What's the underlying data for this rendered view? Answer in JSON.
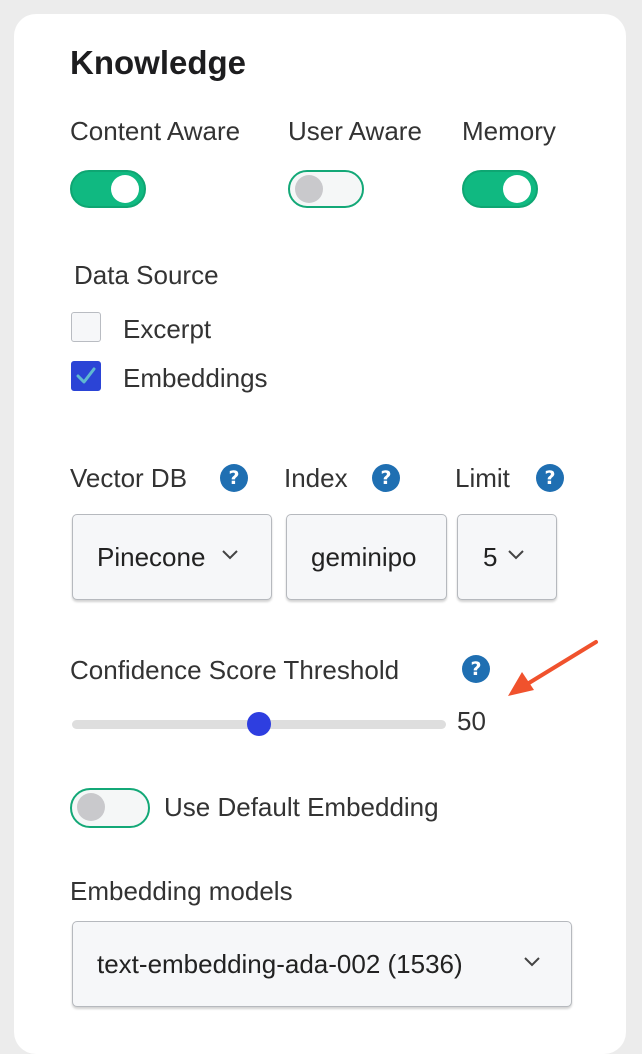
{
  "section": {
    "title": "Knowledge"
  },
  "toggles": [
    {
      "label": "Content Aware",
      "on": true
    },
    {
      "label": "User Aware",
      "on": false
    },
    {
      "label": "Memory",
      "on": true
    }
  ],
  "data_source": {
    "label": "Data Source",
    "options": [
      {
        "label": "Excerpt",
        "checked": false
      },
      {
        "label": "Embeddings",
        "checked": true
      }
    ]
  },
  "vector_db": {
    "label": "Vector DB",
    "value": "Pinecone",
    "help_icon": "question-circle"
  },
  "index": {
    "label": "Index",
    "value": "geminipo",
    "help_icon": "question-circle"
  },
  "limit": {
    "label": "Limit",
    "value": "5",
    "help_icon": "question-circle"
  },
  "confidence": {
    "label": "Confidence Score Threshold",
    "value": "50",
    "fraction": 0.5,
    "help_icon": "question-circle"
  },
  "use_default_embedding": {
    "label": "Use Default Embedding",
    "on": false
  },
  "embedding_models": {
    "label": "Embedding models",
    "value": "text-embedding-ada-002 (1536)"
  },
  "colors": {
    "toggle_on": "#10b981",
    "accent_blue": "#2b44d6",
    "help_blue": "#1f6fb2",
    "annotation_arrow": "#f0522d"
  }
}
